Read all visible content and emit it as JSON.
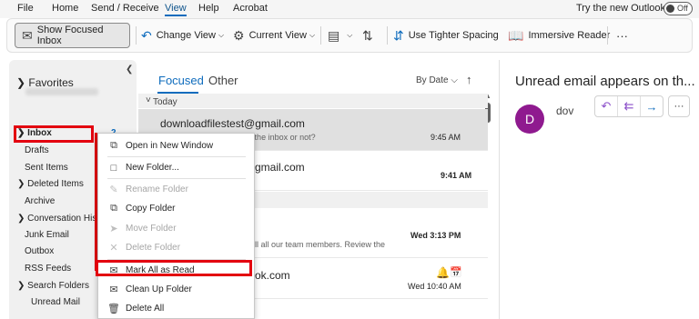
{
  "menubar": {
    "items": [
      "File",
      "Home",
      "Send / Receive",
      "View",
      "Help",
      "Acrobat"
    ],
    "active": "View",
    "try_new_outlook": "Try the new Outlook",
    "toggle_state": "Off"
  },
  "ribbon": {
    "show_focused_inbox": "Show Focused Inbox",
    "change_view": "Change View",
    "current_view": "Current View",
    "use_tighter_spacing": "Use Tighter Spacing",
    "immersive_reader": "Immersive Reader",
    "more": "···"
  },
  "folders": {
    "favorites": "Favorites",
    "inbox": "Inbox",
    "inbox_count": "2",
    "items": [
      "Drafts",
      "Sent Items",
      "Deleted Items",
      "Archive",
      "Conversation Histo",
      "Junk Email",
      "Outbox",
      "RSS Feeds",
      "Search Folders",
      "Unread Mail"
    ]
  },
  "messages": {
    "tabs": [
      "Focused",
      "Other"
    ],
    "sort": "By Date",
    "group_today": "Today",
    "rows": [
      {
        "sender": "downloadfilestest@gmail.com",
        "preview": "Unread email appears on the inbox or not?",
        "time": "9:45 AM"
      },
      {
        "sender": "gmail.com",
        "preview": "",
        "time": "9:41 AM"
      },
      {
        "sender": "",
        "preview": "ll all our team members.  Review the",
        "time": "Wed 3:13 PM"
      },
      {
        "sender": "ok.com",
        "preview": "",
        "time": "Wed 10:40 AM"
      }
    ]
  },
  "reading": {
    "subject": "Unread email appears on th...",
    "avatar_letter": "D",
    "from": "dov"
  },
  "context_menu": {
    "items": [
      {
        "label": "Open in New Window",
        "disabled": false
      },
      {
        "label": "New Folder...",
        "disabled": false
      },
      {
        "label": "Rename Folder",
        "disabled": true
      },
      {
        "label": "Copy Folder",
        "disabled": false
      },
      {
        "label": "Move Folder",
        "disabled": true
      },
      {
        "label": "Delete Folder",
        "disabled": true
      },
      {
        "label": "Mark All as Read",
        "disabled": false
      },
      {
        "label": "Clean Up Folder",
        "disabled": false
      },
      {
        "label": "Delete All",
        "disabled": false
      }
    ]
  },
  "colors": {
    "accent": "#0f6cbd",
    "highlight_red": "#e3000f",
    "avatar": "#8f1a8f"
  }
}
